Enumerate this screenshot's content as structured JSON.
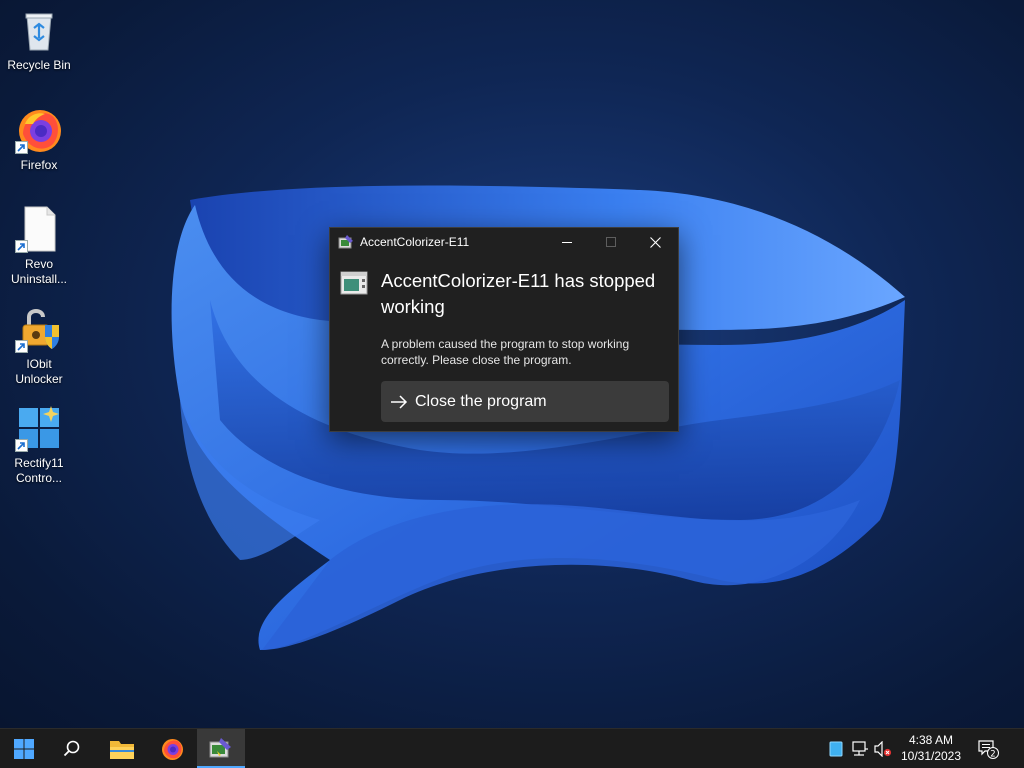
{
  "desktop": {
    "icons": [
      {
        "label": "Recycle Bin",
        "icon": "recycle-bin-icon"
      },
      {
        "label": "Firefox",
        "icon": "firefox-icon"
      },
      {
        "label": "Revo Uninstall...",
        "icon": "file-icon"
      },
      {
        "label": "IObit Unlocker",
        "icon": "lock-shield-icon"
      },
      {
        "label": "Rectify11 Contro...",
        "icon": "windows-logo-icon"
      }
    ]
  },
  "dialog": {
    "title": "AccentColorizer-E11",
    "heading": "AccentColorizer-E11 has stopped working",
    "message": "A problem caused the program to stop working correctly. Please close the program.",
    "action_label": "Close the program",
    "caption_buttons": [
      "minimize",
      "maximize",
      "close"
    ]
  },
  "taskbar": {
    "pinned": [
      "start",
      "search",
      "file-explorer",
      "firefox",
      "accentcolorizer"
    ],
    "tray": {
      "time": "4:38 AM",
      "date": "10/31/2023",
      "notification_count": "2"
    }
  },
  "colors": {
    "accent": "#4fa8ff",
    "dialog_bg": "#202020",
    "button_bg": "#3b3b3b",
    "taskbar_bg": "#1c1c1c"
  }
}
